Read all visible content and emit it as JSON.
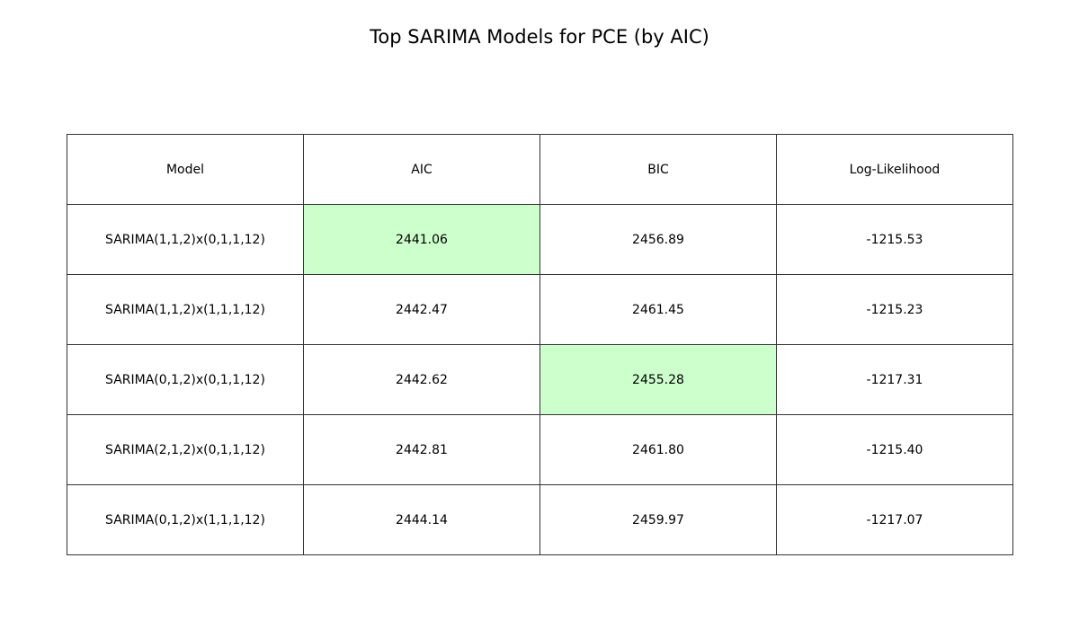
{
  "chart_data": {
    "type": "table",
    "title": "Top SARIMA Models for PCE (by AIC)",
    "columns": [
      "Model",
      "AIC",
      "BIC",
      "Log-Likelihood"
    ],
    "rows": [
      [
        "SARIMA(1,1,2)x(0,1,1,12)",
        "2441.06",
        "2456.89",
        "-1215.53"
      ],
      [
        "SARIMA(1,1,2)x(1,1,1,12)",
        "2442.47",
        "2461.45",
        "-1215.23"
      ],
      [
        "SARIMA(0,1,2)x(0,1,1,12)",
        "2442.62",
        "2455.28",
        "-1217.31"
      ],
      [
        "SARIMA(2,1,2)x(0,1,1,12)",
        "2442.81",
        "2461.80",
        "-1215.40"
      ],
      [
        "SARIMA(0,1,2)x(1,1,1,12)",
        "2444.14",
        "2459.97",
        "-1217.07"
      ]
    ],
    "highlight_color": "#ccffcc",
    "highlighted_cells": [
      {
        "row": 0,
        "col": 1
      },
      {
        "row": 2,
        "col": 2
      }
    ]
  }
}
